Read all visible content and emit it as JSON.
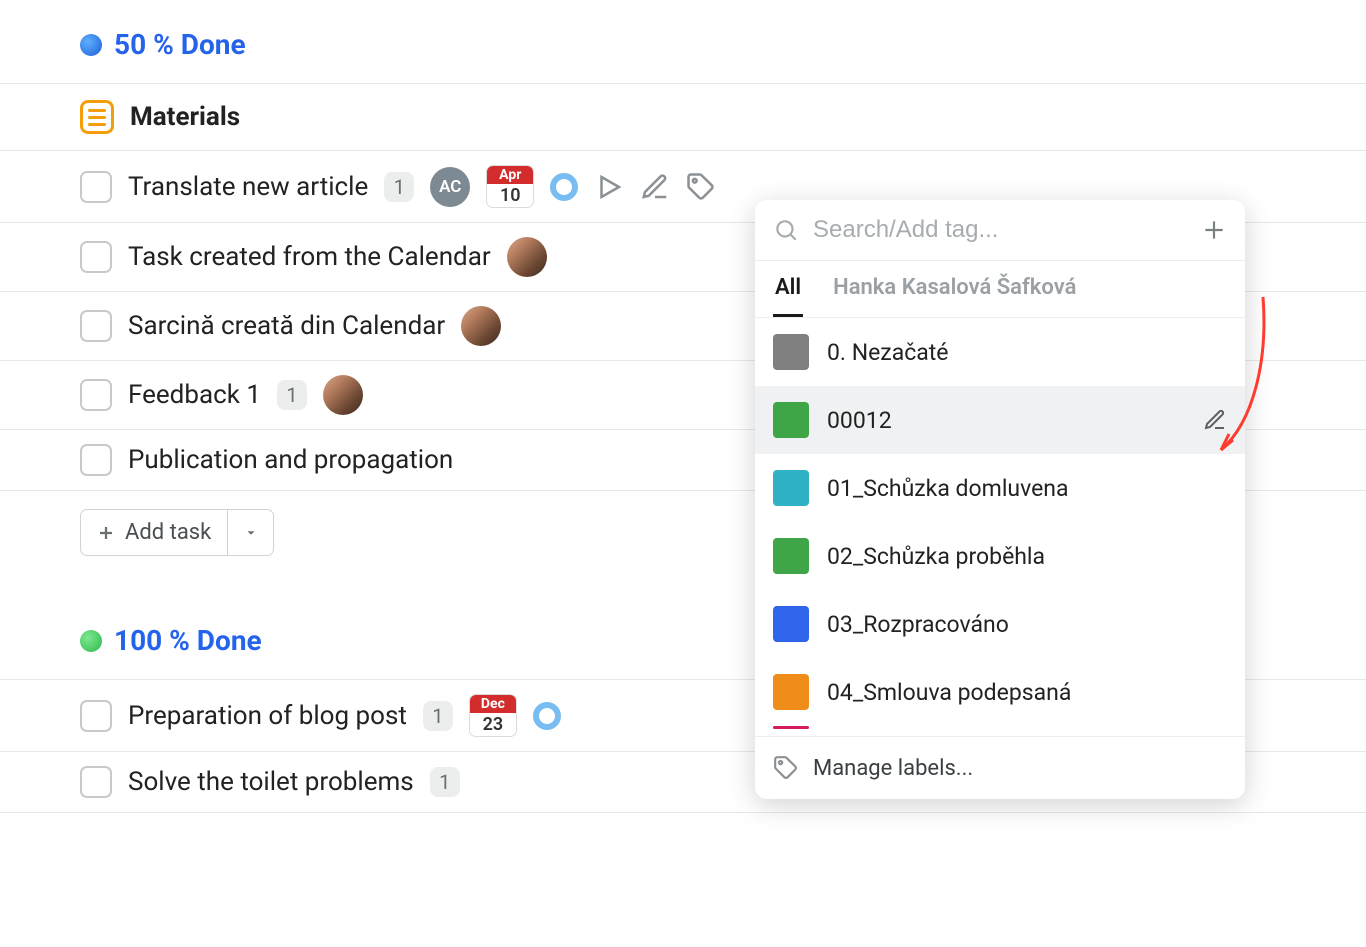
{
  "sections": [
    {
      "dot_color": "status-blue",
      "title": "50 % Done",
      "tasks": [
        {
          "type": "materials",
          "title": "Materials"
        },
        {
          "type": "task",
          "title": "Translate new article",
          "count": "1",
          "avatar": "AC",
          "date": {
            "month": "Apr",
            "day": "10"
          },
          "ring": true,
          "actions": true
        },
        {
          "type": "task",
          "title": "Task created from the Calendar",
          "photo": true
        },
        {
          "type": "task",
          "title": "Sarcină creată din Calendar",
          "photo": true
        },
        {
          "type": "task",
          "title": "Feedback 1",
          "count": "1",
          "photo": true,
          "warning": "orange"
        },
        {
          "type": "task",
          "title": "Publication and propagation"
        }
      ],
      "add_label": "Add task"
    },
    {
      "dot_color": "status-green",
      "title": "100 % Done",
      "tasks": [
        {
          "type": "task",
          "title": "Preparation of blog post",
          "count": "1",
          "date": {
            "month": "Dec",
            "day": "23"
          },
          "ring": true
        },
        {
          "type": "task",
          "title": "Solve the toilet problems",
          "count": "1",
          "warning": "red"
        }
      ]
    }
  ],
  "popover": {
    "placeholder": "Search/Add tag...",
    "tabs": [
      "All",
      "Hanka Kasalová Šafková"
    ],
    "tags": [
      {
        "name": "0. Nezačaté",
        "color": "#808080"
      },
      {
        "name": "00012",
        "color": "#3fa648",
        "hover": true
      },
      {
        "name": "01_Schůzka domluvena",
        "color": "#2fb2c4"
      },
      {
        "name": "02_Schůzka proběhla",
        "color": "#3fa648"
      },
      {
        "name": "03_Rozpracováno",
        "color": "#3064ea"
      },
      {
        "name": "04_Smlouva podepsaná",
        "color": "#f08c1a"
      }
    ],
    "footer": "Manage labels..."
  }
}
